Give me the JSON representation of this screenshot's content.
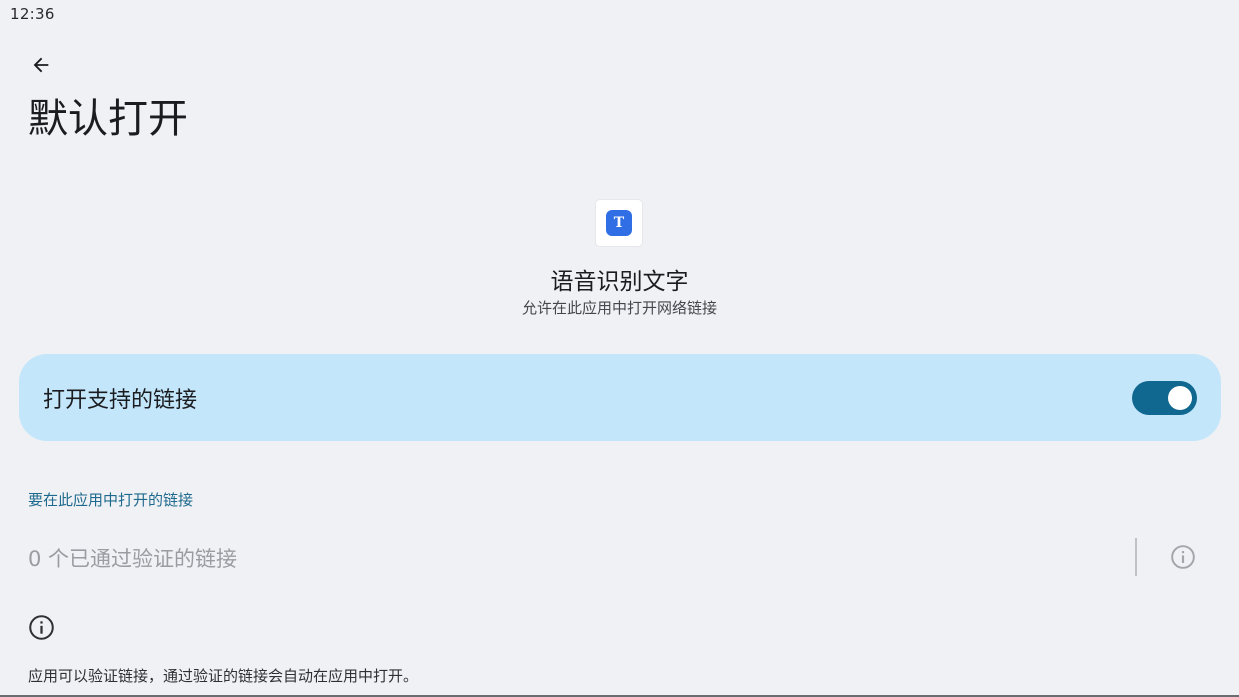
{
  "status_bar": {
    "time": "12:36"
  },
  "header": {
    "back_icon": "arrow-left-icon",
    "title": "默认打开"
  },
  "app": {
    "icon": "text-app-icon",
    "icon_letter": "T",
    "icon_color": "#2f6ee5",
    "name": "语音识别文字",
    "subtitle": "允许在此应用中打开网络链接"
  },
  "toggle": {
    "label": "打开支持的链接",
    "state": "on",
    "accent": "#10678f",
    "card_color": "#c3e6fb"
  },
  "links_section": {
    "header": "要在此应用中打开的链接",
    "verified_links": "0 个已通过验证的链接",
    "info_icon": "info-circle-icon"
  },
  "footer": {
    "info_icon": "info-circle-icon",
    "text": "应用可以验证链接，通过验证的链接会自动在应用中打开。"
  }
}
